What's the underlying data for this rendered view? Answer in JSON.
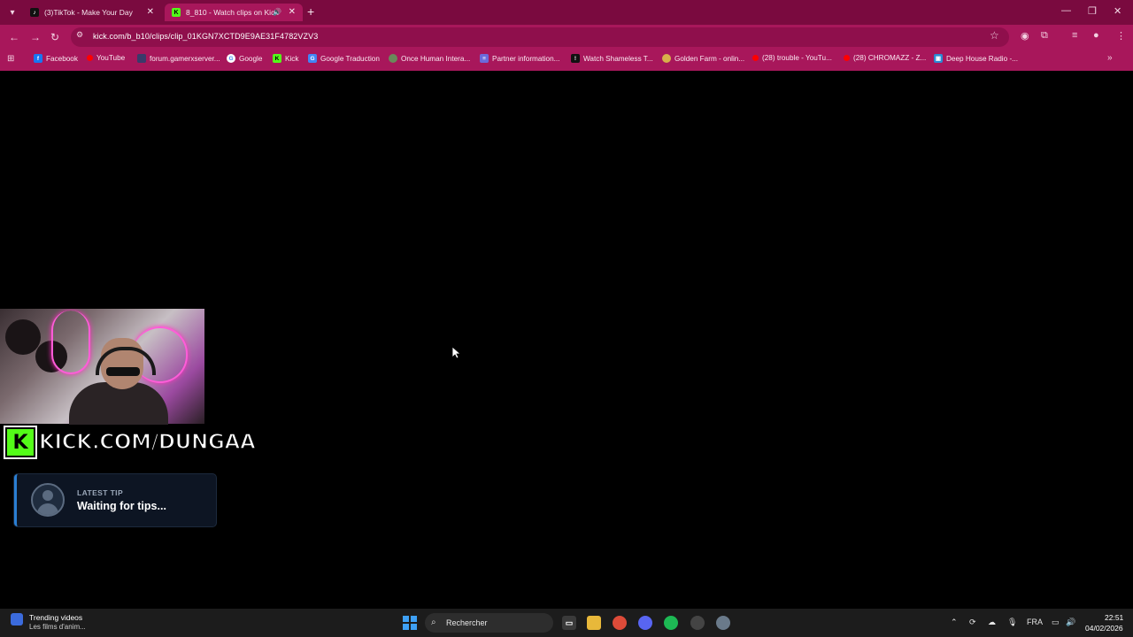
{
  "browser": {
    "tabs": [
      {
        "label": "(3)TikTok - Make Your Day",
        "active": false
      },
      {
        "label": "8_810 - Watch clips on Kick",
        "active": true
      }
    ],
    "url": "kick.com/b_b10/clips/clip_01KGN7XCTD9E9AE31F4782VZV3",
    "bookmarks": [
      {
        "label": "Facebook",
        "icon": "facebook-icon",
        "color": "#1877f2"
      },
      {
        "label": "YouTube",
        "icon": "youtube-icon",
        "color": "#ff0000"
      },
      {
        "label": "forum.gamerxserver...",
        "icon": "forum-icon",
        "color": "#3a3a6a"
      },
      {
        "label": "Google",
        "icon": "google-icon",
        "color": "#ffffff"
      },
      {
        "label": "Kick",
        "icon": "kick-icon",
        "color": "#53fc18"
      },
      {
        "label": "Google Traduction",
        "icon": "translate-icon",
        "color": "#4285f4"
      },
      {
        "label": "Once Human Intera...",
        "icon": "once-human-icon",
        "color": "#6a8a5a"
      },
      {
        "label": "Partner information...",
        "icon": "list-icon",
        "color": "#6a6adc"
      },
      {
        "label": "Watch Shameless T...",
        "icon": "shameless-icon",
        "color": "#111111"
      },
      {
        "label": "Golden Farm - onlin...",
        "icon": "golden-farm-icon",
        "color": "#d8b04a"
      },
      {
        "label": "(28) trouble - YouTu...",
        "icon": "youtube-icon",
        "color": "#ff0000"
      },
      {
        "label": "(28) CHROMAZZ - Z...",
        "icon": "youtube-icon",
        "color": "#ff0000"
      },
      {
        "label": "Deep House Radio -...",
        "icon": "radio-icon",
        "color": "#2a8ad4"
      }
    ]
  },
  "stream": {
    "banner": "KICK.COM/DUNGAA",
    "tip_label": "LATEST TIP",
    "tip_value": "Waiting for tips..."
  },
  "taskbar": {
    "widget_title": "Trending videos",
    "widget_sub": "Les films d'anim...",
    "search_placeholder": "Rechercher",
    "language": "FRA",
    "time": "22:51",
    "date": "04/02/2026"
  },
  "colors": {
    "chrome_frame": "#7a0a3f",
    "chrome_toolbar": "#a8175b",
    "kick_green": "#53fc18",
    "tip_accent": "#2a7fd4"
  }
}
